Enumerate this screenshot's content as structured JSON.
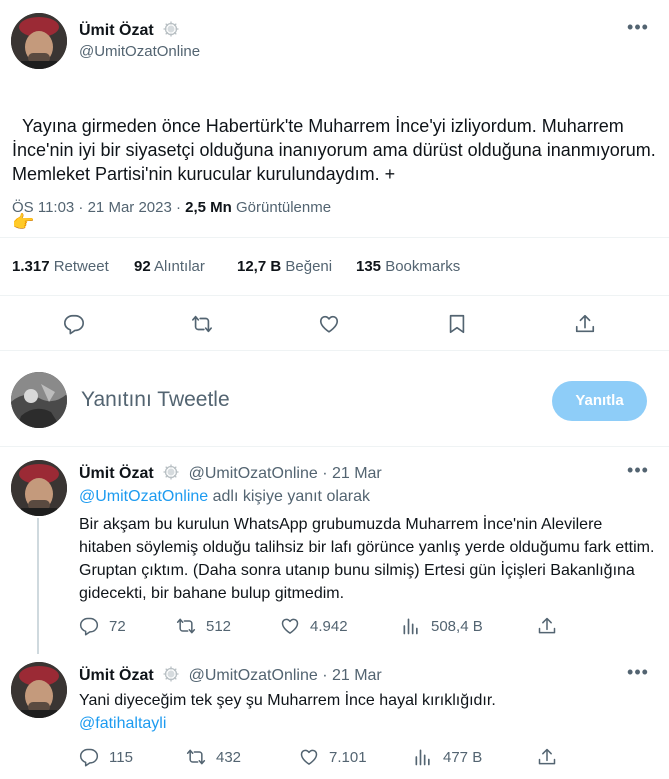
{
  "main_tweet": {
    "author_name": "Ümit Özat",
    "handle": "@UmitOzatOnline",
    "text": "Yayına girmeden önce Habertürk'te Muharrem İnce'yi izliyordum. Muharrem İnce'nin iyi bir siyasetçi olduğuna inanıyorum ama dürüst olduğuna inanmıyorum. Memleket Partisi'nin kurucular kurulundaydım. +",
    "emoji": "👉",
    "time": "ÖS 11:03 · 21 Mar 2023 · ",
    "views_count": "2,5 Mn",
    "views_label": "Görüntülenme",
    "stats": {
      "retweets_count": "1.317",
      "retweets_label": "Retweet",
      "quotes_count": "92",
      "quotes_label": "Alıntılar",
      "likes_count": "12,7 B",
      "likes_label": "Beğeni",
      "bookmarks_count": "135",
      "bookmarks_label": "Bookmarks"
    }
  },
  "reply_box": {
    "placeholder": "Yanıtını Tweetle",
    "button_label": "Yanıtla"
  },
  "replies": [
    {
      "author_name": "Ümit Özat",
      "handle_time": "@UmitOzatOnline · 21 Mar",
      "reply_to_handle": "@UmitOzatOnline",
      "reply_to_suffix": " adlı kişiye yanıt olarak",
      "text": "Bir akşam bu kurulun WhatsApp grubumuzda Muharrem İnce'nin Alevilere hitaben söylemiş olduğu talihsiz bir lafı görünce yanlış yerde olduğumu fark ettim. Gruptan çıktım. (Daha sonra utanıp bunu silmiş) Ertesi gün İçişleri Bakanlığına gidecekti, bir bahane bulup gitmedim.",
      "replies": "72",
      "retweets": "512",
      "likes": "4.942",
      "views": "508,4 B"
    },
    {
      "author_name": "Ümit Özat",
      "handle_time": "@UmitOzatOnline · 21 Mar",
      "text": "Yani diyeceğim tek şey şu Muharrem İnce hayal kırıklığıdır.",
      "mention": "@fatihaltayli",
      "replies": "115",
      "retweets": "432",
      "likes": "7.101",
      "views": "477 B"
    }
  ],
  "icons": {
    "more": "more-icon",
    "verified": "verified-badge-icon",
    "reply": "reply-icon",
    "retweet": "retweet-icon",
    "like": "heart-icon",
    "bookmark": "bookmark-icon",
    "share": "share-icon",
    "views": "views-icon"
  },
  "colors": {
    "accent": "#1d9bf0",
    "button_disabled": "#8ecdf8",
    "muted": "#536471",
    "text": "#0f1419"
  }
}
